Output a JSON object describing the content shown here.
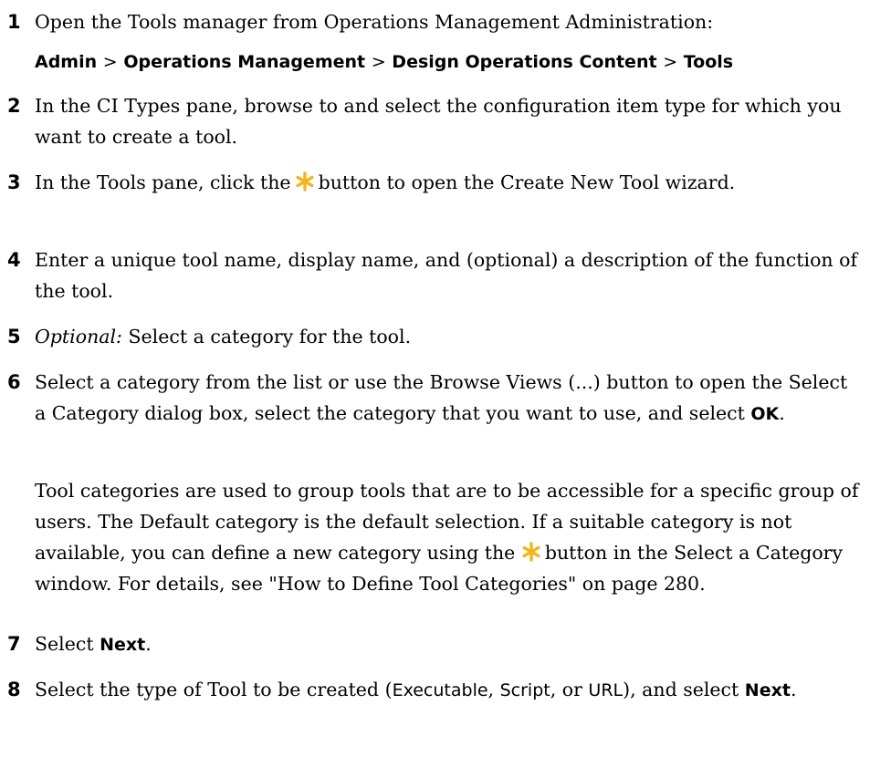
{
  "steps": [
    {
      "number": "1",
      "text": "Open the Tools manager from Operations Management Administration:",
      "path": [
        "Admin",
        "Operations Management",
        "Design Operations Content",
        "Tools"
      ],
      "separator": ">"
    },
    {
      "number": "2",
      "text": "In the CI Types pane, browse to and select the configuration item type for which you want to create a tool."
    },
    {
      "number": "3",
      "text_before": "In the Tools pane, click the",
      "icon": "new-item-star-icon",
      "text_after": "button to open the Create New Tool wizard."
    },
    {
      "number": "4",
      "text": "Enter a unique tool name, display name, and (optional) a description of the function of the tool."
    },
    {
      "number": "5",
      "italic_prefix": "Optional:",
      "text": "Select a category for the tool."
    },
    {
      "number": "6",
      "text_before": "Select a category from the list or use the Browse Views (...) button to open the Select a Category dialog box, select the category that you want to use, and select",
      "bold_term": "OK",
      "text_after": ".",
      "note_line1": "Tool categories are used to group tools that are to be accessible for a specific group of users. The Default category is the default selection. If a suitable category is not available, you can define a new category using the",
      "note_icon": "new-item-star-icon",
      "note_line2": "button in the Select a Category window. For details, see \"How to Define Tool Categories\" on page 280."
    },
    {
      "number": "7",
      "text_before": "Select",
      "bold_term": "Next",
      "text_after": "."
    },
    {
      "number": "8",
      "text_before": "Select the type of Tool to be created (",
      "type_1": "Executable",
      "comma_1": ", ",
      "type_2": "Script",
      "comma_2": ", or ",
      "type_3": "URL",
      "text_mid": "), and select",
      "bold_term": "Next",
      "text_after": "."
    }
  ],
  "colors": {
    "icon_star": "#f2b51c",
    "text": "#000000",
    "background": "#ffffff"
  }
}
